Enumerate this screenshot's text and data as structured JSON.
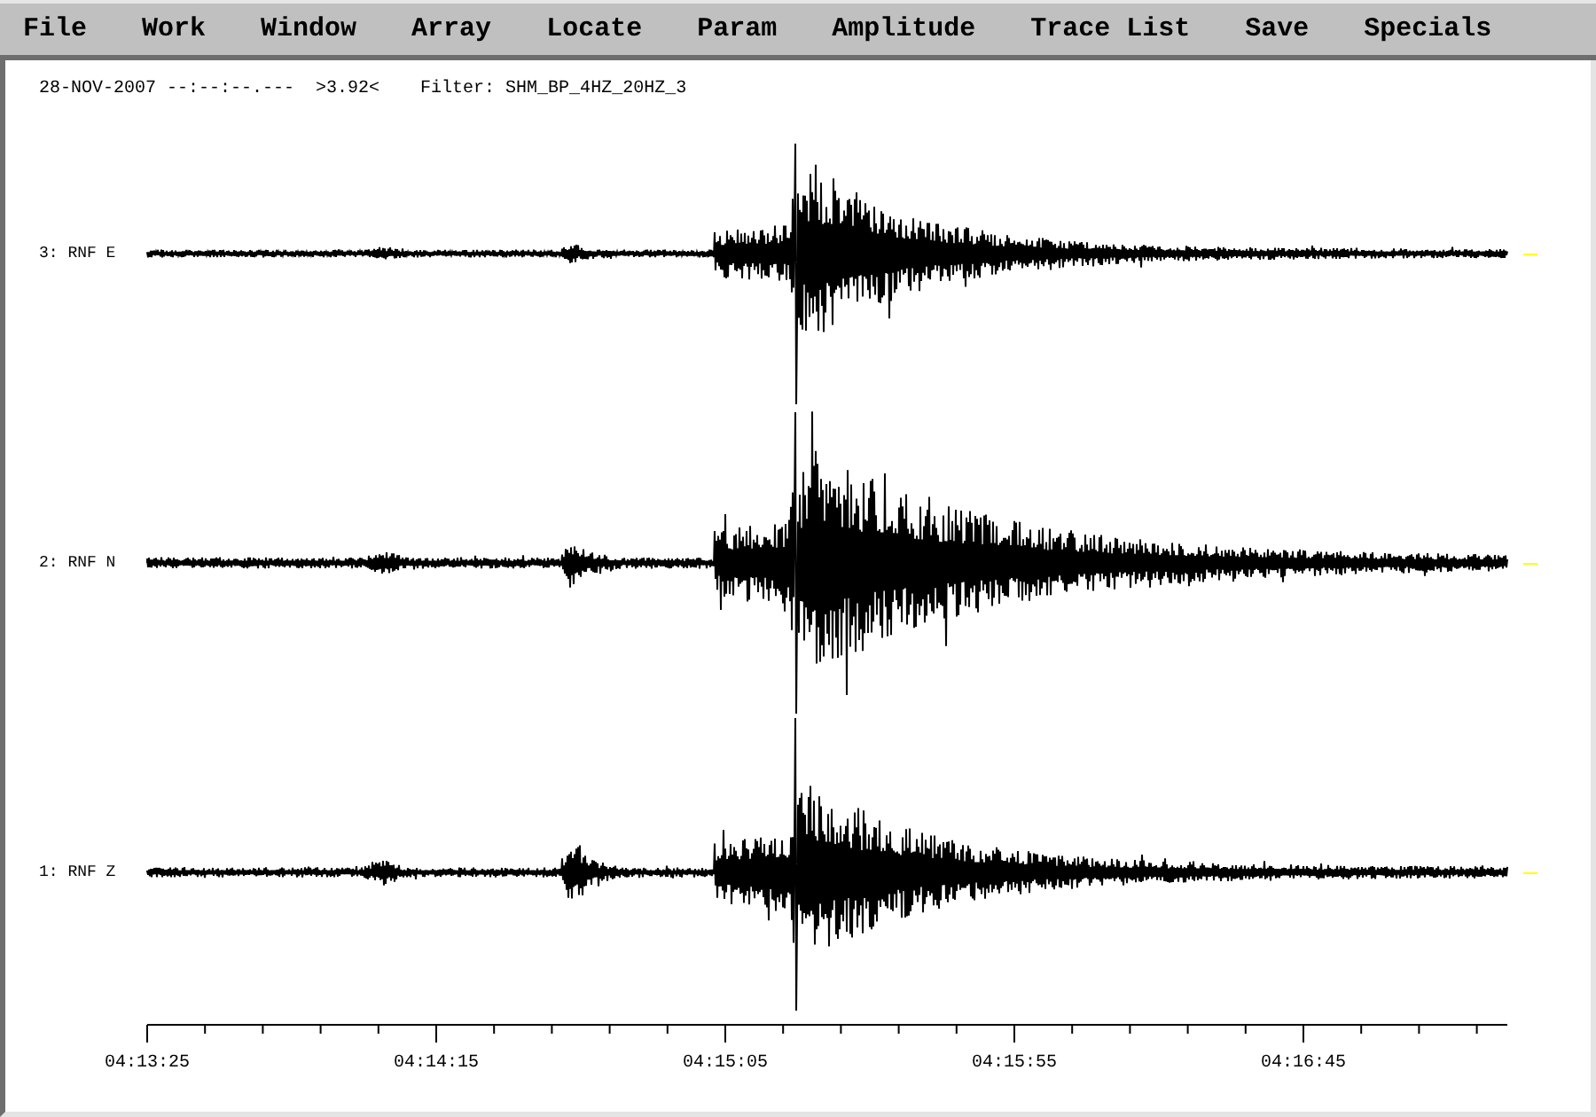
{
  "menu_bar": {
    "items": [
      "File",
      "Work",
      "Window",
      "Array",
      "Locate",
      "Param",
      "Amplitude",
      "Trace List",
      "Save",
      "Specials"
    ]
  },
  "header": {
    "date_time": "28-NOV-2007 --:--:--.---",
    "amplitude": ">3.92<",
    "filter": "Filter: SHM_BP_4HZ_20HZ_3"
  },
  "traces": [
    {
      "label": "3: RNF E"
    },
    {
      "label": "2: RNF N"
    },
    {
      "label": "1: RNF Z"
    }
  ],
  "time_axis": {
    "tick_labels": [
      "04:13:25",
      "04:14:15",
      "04:15:05",
      "04:15:55",
      "04:16:45"
    ]
  }
}
